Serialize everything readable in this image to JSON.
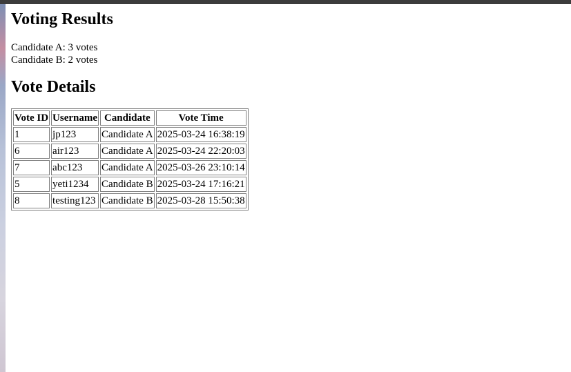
{
  "results": {
    "title": "Voting Results",
    "lines": [
      "Candidate A: 3 votes",
      "Candidate B: 2 votes"
    ]
  },
  "details": {
    "title": "Vote Details",
    "headers": [
      "Vote ID",
      "Username",
      "Candidate",
      "Vote Time"
    ],
    "rows": [
      [
        "1",
        "jp123",
        "Candidate A",
        "2025-03-24 16:38:19"
      ],
      [
        "6",
        "air123",
        "Candidate A",
        "2025-03-24 22:20:03"
      ],
      [
        "7",
        "abc123",
        "Candidate A",
        "2025-03-26 23:10:14"
      ],
      [
        "5",
        "yeti1234",
        "Candidate B",
        "2025-03-24 17:16:21"
      ],
      [
        "8",
        "testing123",
        "Candidate B",
        "2025-03-28 15:50:38"
      ]
    ]
  }
}
